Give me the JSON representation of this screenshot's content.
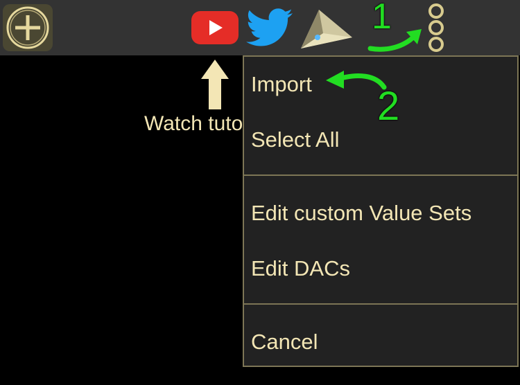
{
  "toolbar": {
    "add_icon": "plus-circle-icon",
    "youtube_icon": "youtube-icon",
    "twitter_icon": "twitter-icon",
    "plane_icon": "paper-plane-icon",
    "overflow_icon": "vertical-ellipsis-icon"
  },
  "annotations": {
    "step1": "1",
    "step2": "2",
    "watch_text": "Watch tuto"
  },
  "menu": {
    "items": [
      {
        "label": "Import"
      },
      {
        "label": "Select All"
      },
      {
        "label": "Edit custom Value Sets"
      },
      {
        "label": "Edit DACs"
      },
      {
        "label": "Cancel"
      }
    ]
  },
  "colors": {
    "accent_text": "#f3e6b5",
    "annotation_green": "#22dd22",
    "menu_border": "#7d7656",
    "menu_bg": "#222222",
    "toolbar_bg": "#333333"
  }
}
